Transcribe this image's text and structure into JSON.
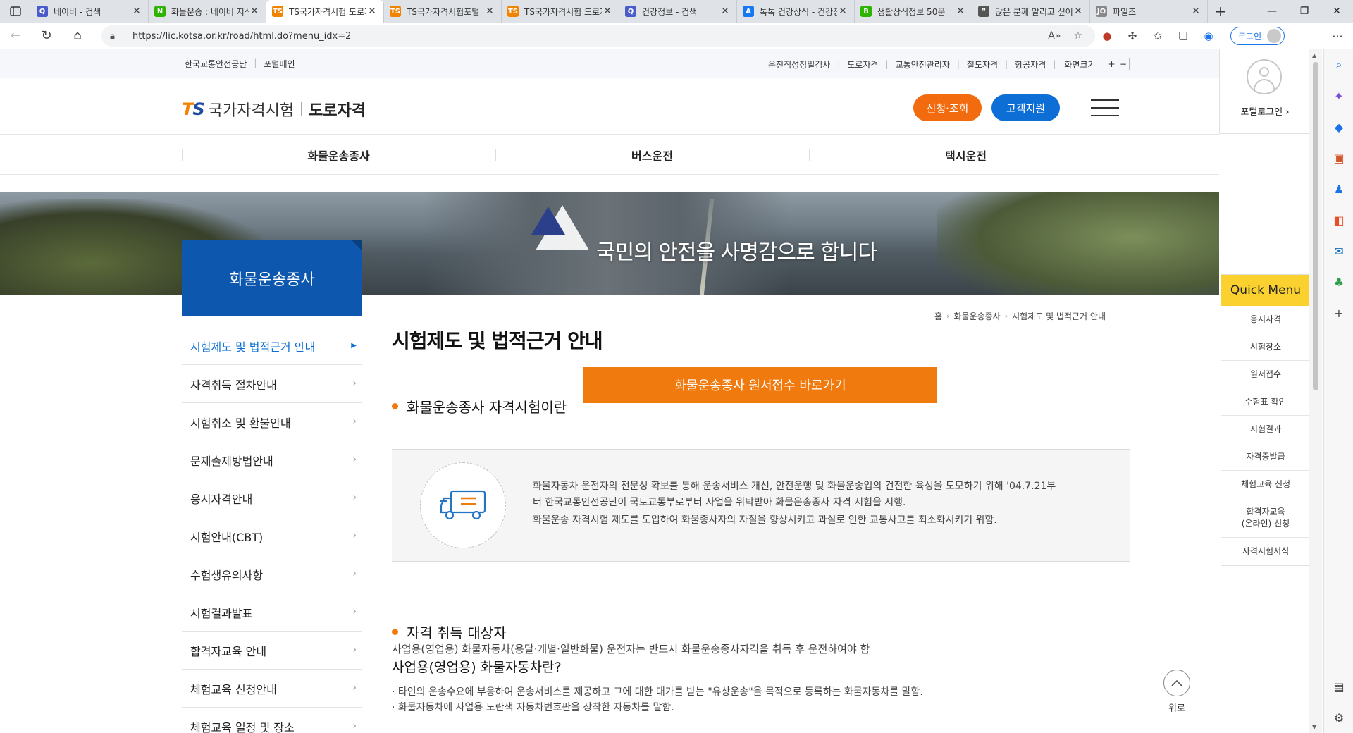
{
  "browser": {
    "tabs": [
      {
        "title": "네이버 - 검색",
        "fav": "Q",
        "fav_color": "#4a5cc9",
        "active": false
      },
      {
        "title": "화물운송 : 네이버 지식백과",
        "fav": "N",
        "fav_color": "#2db400",
        "active": false
      },
      {
        "title": "TS국가자격시험 도로자격",
        "fav": "TS",
        "fav_color": "#f08300",
        "active": true
      },
      {
        "title": "TS국가자격시험포털",
        "fav": "TS",
        "fav_color": "#f08300",
        "active": false
      },
      {
        "title": "TS국가자격시험 도로자격",
        "fav": "TS",
        "fav_color": "#f08300",
        "active": false
      },
      {
        "title": "건강정보 - 검색",
        "fav": "Q",
        "fav_color": "#4a5cc9",
        "active": false
      },
      {
        "title": "톡톡 건강상식 - 건강정보",
        "fav": "A",
        "fav_color": "#1877f2",
        "active": false
      },
      {
        "title": "생활상식정보 50문",
        "fav": "B",
        "fav_color": "#2db400",
        "active": false
      },
      {
        "title": "많은 분께 알리고 싶어요",
        "fav": "❞",
        "fav_color": "#555555",
        "active": false
      },
      {
        "title": "파일조",
        "fav": "JO",
        "fav_color": "#888888",
        "active": false
      }
    ],
    "url": "https://lic.kotsa.or.kr/road/html.do?menu_idx=2",
    "login_label": "로그인"
  },
  "util": {
    "left_links": [
      "한국교통안전공단",
      "포털메인"
    ],
    "right_links": [
      "운전적성정밀검사",
      "도로자격",
      "교통안전관리자",
      "철도자격",
      "항공자격"
    ],
    "zoom_label": "화면크기",
    "zoom_plus": "+",
    "zoom_minus": "−"
  },
  "portal": {
    "label": "포털로그인 ›"
  },
  "header": {
    "logo_ts_a": "T",
    "logo_ts_b": "S",
    "logo_name": "국가자격시험",
    "logo_sub": "도로자격",
    "apply_label": "신청·조회",
    "cs_label": "고객지원"
  },
  "gnb": [
    "화물운송종사",
    "버스운전",
    "택시운전"
  ],
  "banner": {
    "slogan": "국민의 안전을 사명감으로 합니다"
  },
  "lnb": {
    "title": "화물운송종사",
    "items": [
      "시험제도 및 법적근거 안내",
      "자격취득 절차안내",
      "시험취소 및 환불안내",
      "문제출제방법안내",
      "응시자격안내",
      "시험안내(CBT)",
      "수험생유의사항",
      "시험결과발표",
      "합격자교육 안내",
      "체험교육 신청안내",
      "체험교육 일정 및 장소"
    ],
    "active_index": 0
  },
  "breadcrumb": [
    "홈",
    "화물운송종사",
    "시험제도 및 법적근거 안내"
  ],
  "content": {
    "title": "시험제도 및 법적근거 안내",
    "go_button": "화물운송종사 원서접수 바로가기",
    "sec1_title": "화물운송종사 자격시험이란",
    "sec1_line1": "화물자동차 운전자의 전문성 확보를 통해 운송서비스 개선, 안전운행 및 화물운송업의 건전한 육성을 도모하기 위해 '04.7.21부",
    "sec1_line2": "터 한국교통안전공단이 국토교통부로부터 사업을 위탁받아 화물운송종사 자격 시험을 시행.",
    "sec1_line3": "화물운송 자격시험 제도를 도입하여 화물종사자의 자질을 향상시키고 과실로 인한 교통사고를 최소화시키기 위함.",
    "sec2_title": "자격 취득 대상자",
    "sec2_text": "사업용(영업용) 화물자동차(용달·개별·일반화물) 운전자는 반드시 화물운송종사자격을 취득 후 운전하여야 함",
    "sub_title": "사업용(영업용) 화물자동차란?",
    "bullet1": "· 타인의 운송수요에 부응하여 운송서비스를 제공하고 그에 대한 대가를 받는 \"유상운송\"을 목적으로 등록하는 화물자동차를 말함.",
    "bullet2": "· 화물자동차에 사업용 노란색 자동차번호판을 장착한 자동차를 말함."
  },
  "quick_menu": {
    "title": "Quick Menu",
    "items": [
      "응시자격",
      "시험장소",
      "원서접수",
      "수험표 확인",
      "시험결과",
      "자격증발급",
      "체험교육 신청",
      "합격자교육\n(온라인) 신청",
      "자격시험서식"
    ]
  },
  "top_button": {
    "label": "위로"
  },
  "colors": {
    "orange": "#f07a0d",
    "blue": "#0d58ae",
    "quick_yellow": "#fbd130"
  }
}
